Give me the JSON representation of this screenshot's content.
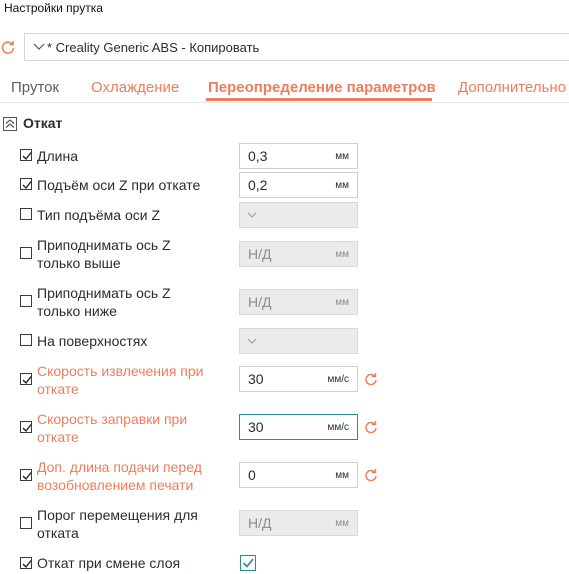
{
  "window": {
    "title": "Настройки прутка"
  },
  "preset": {
    "name": "* Creality Generic ABS - Копировать"
  },
  "tabs": [
    {
      "label": "Пруток"
    },
    {
      "label": "Охлаждение"
    },
    {
      "label": "Переопределение параметров"
    },
    {
      "label": "Дополнительно"
    }
  ],
  "section": {
    "title": "Откат"
  },
  "rows": [
    {
      "label": "Длина",
      "checked": true,
      "value": "0,3",
      "unit": "мм"
    },
    {
      "label": "Подъём оси Z при откате",
      "checked": true,
      "value": "0,2",
      "unit": "мм"
    },
    {
      "label": "Тип подъёма оси Z",
      "checked": false
    },
    {
      "label_line1": "Приподнимать ось Z",
      "label_line2": "только выше",
      "checked": false,
      "value": "Н/Д",
      "unit": "мм"
    },
    {
      "label_line1": "Приподнимать ось Z",
      "label_line2": "только ниже",
      "checked": false,
      "value": "Н/Д",
      "unit": "мм"
    },
    {
      "label": "На поверхностях",
      "checked": false
    },
    {
      "label_line1": "Скорость извлечения при",
      "label_line2": "откате",
      "checked": true,
      "value": "30",
      "unit": "мм/с"
    },
    {
      "label_line1": "Скорость заправки при",
      "label_line2": "откате",
      "checked": true,
      "value": "30",
      "unit": "мм/с"
    },
    {
      "label_line1": "Доп. длина подачи перед",
      "label_line2": "возобновлением печати",
      "checked": true,
      "value": "0",
      "unit": "мм"
    },
    {
      "label_line1": "Порог перемещения для",
      "label_line2": "отката",
      "checked": false,
      "value": "Н/Д",
      "unit": "мм"
    },
    {
      "label": "Откат при смене слоя",
      "checked": true,
      "toggle_on": true
    }
  ],
  "colors": {
    "accent": "#e8805e",
    "teal": "#2a8b8b",
    "text": "#262e30"
  }
}
